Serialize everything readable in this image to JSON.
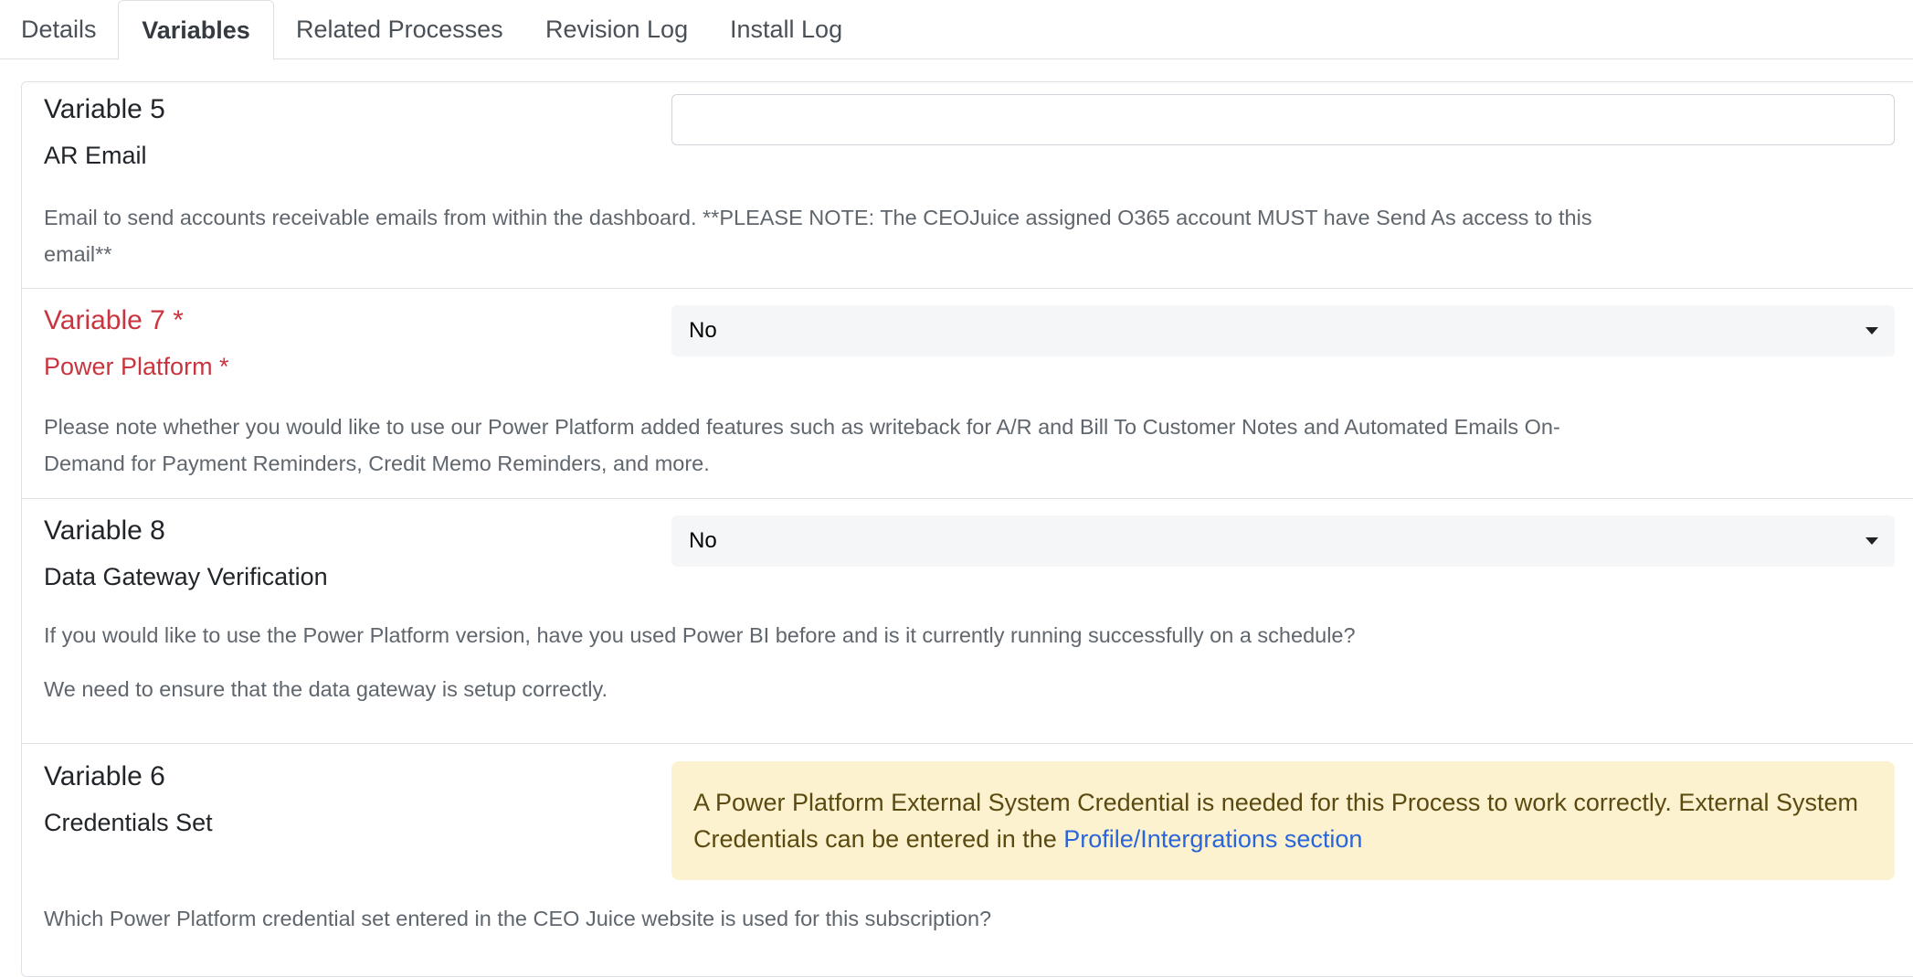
{
  "tabs": [
    {
      "label": "Details"
    },
    {
      "label": "Variables"
    },
    {
      "label": "Related Processes"
    },
    {
      "label": "Revision Log"
    },
    {
      "label": "Install Log"
    }
  ],
  "active_tab": "Variables",
  "variables": {
    "v5": {
      "title": "Variable 5",
      "label": "AR Email",
      "input_value": "",
      "description": "Email to send accounts receivable emails from within the dashboard. **PLEASE NOTE: The CEOJuice assigned O365 account MUST have Send As access to this email**"
    },
    "v7": {
      "title": "Variable 7 *",
      "label": "Power Platform *",
      "selected": "No",
      "description": "Please note whether you would like to use our Power Platform added features such as writeback for A/R and Bill To Customer Notes and Automated Emails On-Demand for Payment Reminders, Credit Memo Reminders, and more."
    },
    "v8": {
      "title": "Variable 8",
      "label": "Data Gateway Verification",
      "selected": "No",
      "description_1": "If you would like to use the Power Platform version, have you used Power BI before and is it currently running successfully on a schedule?",
      "description_2": "We need to ensure that the data gateway is setup correctly."
    },
    "v6": {
      "title": "Variable 6",
      "label": "Credentials Set",
      "alert_text": "A Power Platform External System Credential is needed for this Process to work correctly. External System Credentials can be entered in the ",
      "alert_link": "Profile/Intergrations section",
      "description": "Which Power Platform credential set entered in the CEO Juice website is used for this subscription?"
    }
  },
  "colors": {
    "required": "#c9353f",
    "link": "#2a66d9",
    "alert_bg": "#fdf2d0",
    "select_bg": "#f5f6f8"
  }
}
